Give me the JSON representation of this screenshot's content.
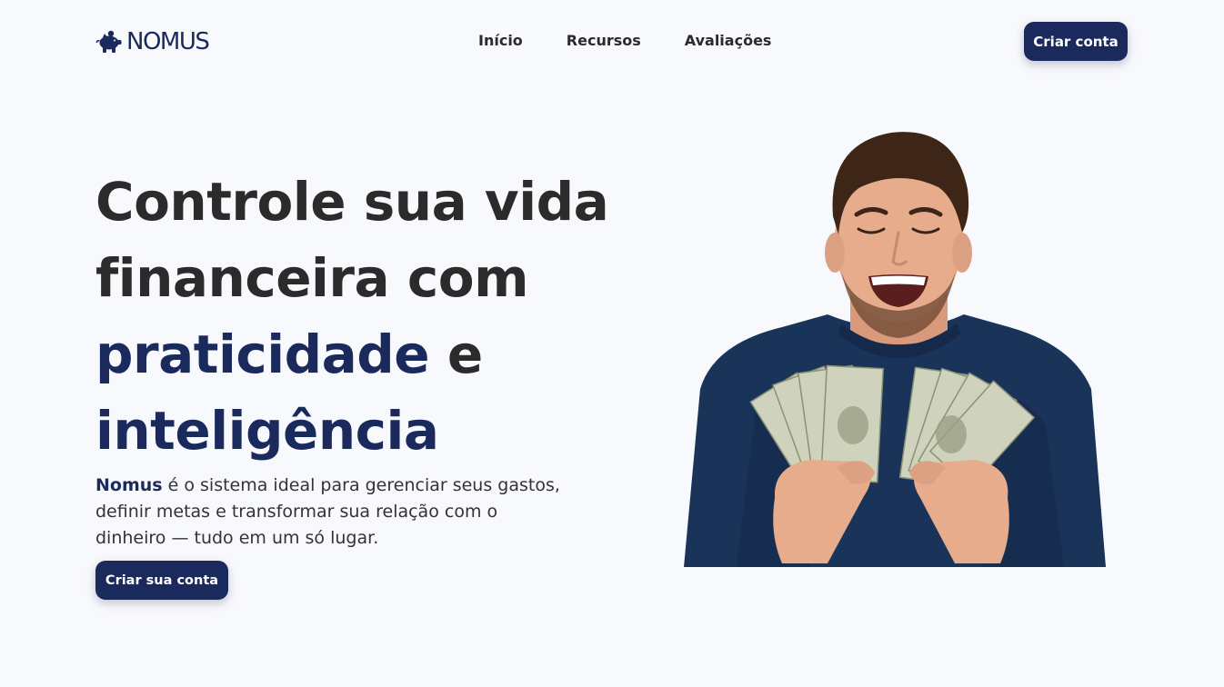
{
  "brand": {
    "name": "NOMUS",
    "logo_icon": "piggy-bank-icon",
    "color": "#1b2a5c"
  },
  "nav": {
    "items": [
      {
        "label": "Início"
      },
      {
        "label": "Recursos"
      },
      {
        "label": "Avaliações"
      }
    ]
  },
  "header": {
    "cta_label": "Criar conta"
  },
  "hero": {
    "title": {
      "line1": "Controle sua vida",
      "line2": "financeira com",
      "line3_accent": "praticidade",
      "line3_rest": " e",
      "line4_accent": "inteligência"
    },
    "description": {
      "brand": "Nomus",
      "text": " é o sistema ideal para gerenciar seus gastos, definir metas e transformar sua relação com o dinheiro — tudo em um só lugar."
    },
    "cta_label": "Criar sua conta",
    "image_icon": "man-holding-cash-illustration"
  },
  "colors": {
    "primary": "#1b2a5c",
    "text": "#2b2b2b",
    "background": "#f8f9fc"
  }
}
